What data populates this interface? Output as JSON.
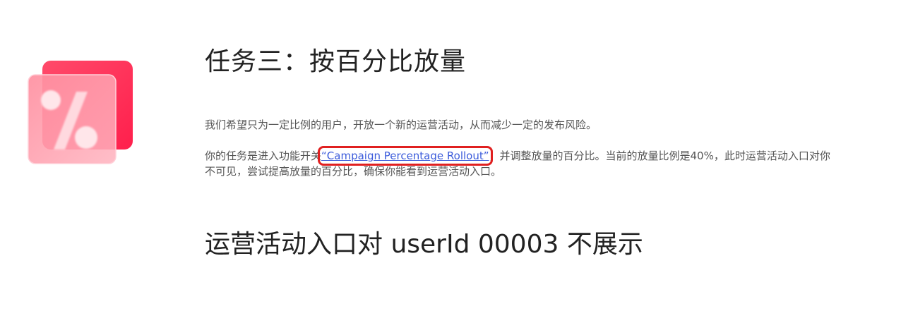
{
  "task": {
    "title": "任务三：按百分比放量",
    "intro": "我们希望只为一定比例的用户，开放一个新的运营活动，从而减少一定的发布风险。",
    "instruction_prefix": "你的任务是进入功能开关",
    "flag_link": "“Campaign Percentage Rollout”",
    "instruction_suffix": "，并调整放量的百分比。当前的放量比例是40%，此时运营活动入口对你不可见，尝试提高放量的百分比，确保你能看到运营活动入口。"
  },
  "status": {
    "heading": "运营活动入口对 userId 00003 不展示"
  },
  "illustration": {
    "icon": "percent-icon",
    "back_card_color": "#ff2d55",
    "front_card_color": "#ff8a9c"
  }
}
